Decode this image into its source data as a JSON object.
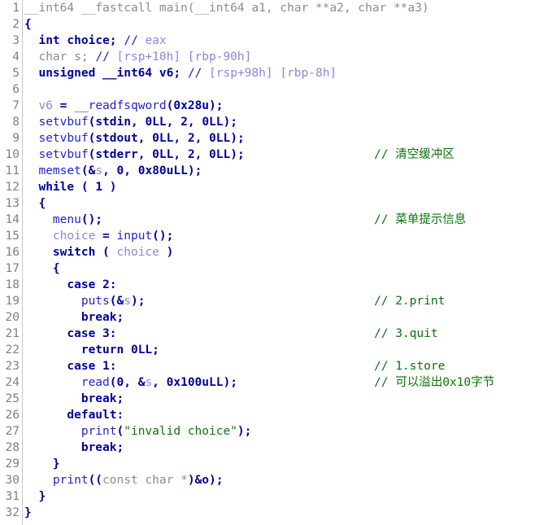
{
  "view": {
    "name": "hex-rays-pseudocode",
    "background": "#ffffff",
    "gutter_color": "#808080",
    "total_lines": 32,
    "colors": {
      "keyword": "#00009a",
      "type_gray": "#8c8c8c",
      "function": "#2424c8",
      "variable": "#8888dd",
      "string": "#087508",
      "comment_green": "#087508",
      "comment_blue": "#8888dd"
    }
  },
  "lines": [
    {
      "n": "1",
      "text": "__int64 __fastcall main(__int64 a1, char **a2, char **a3)",
      "comment": ""
    },
    {
      "n": "2",
      "text": "{",
      "comment": ""
    },
    {
      "n": "3",
      "text": "  int choice; // eax",
      "comment": ""
    },
    {
      "n": "4",
      "text": "  char s; // [rsp+10h] [rbp-90h]",
      "comment": ""
    },
    {
      "n": "5",
      "text": "  unsigned __int64 v6; // [rsp+98h] [rbp-8h]",
      "comment": ""
    },
    {
      "n": "6",
      "text": "",
      "comment": ""
    },
    {
      "n": "7",
      "text": "  v6 = __readfsqword(0x28u);",
      "comment": ""
    },
    {
      "n": "8",
      "text": "  setvbuf(stdin, 0LL, 2, 0LL);",
      "comment": ""
    },
    {
      "n": "9",
      "text": "  setvbuf(stdout, 0LL, 2, 0LL);",
      "comment": ""
    },
    {
      "n": "10",
      "text": "  setvbuf(stderr, 0LL, 2, 0LL);",
      "comment": "// 清空缓冲区"
    },
    {
      "n": "11",
      "text": "  memset(&s, 0, 0x80uLL);",
      "comment": ""
    },
    {
      "n": "12",
      "text": "  while ( 1 )",
      "comment": ""
    },
    {
      "n": "13",
      "text": "  {",
      "comment": ""
    },
    {
      "n": "14",
      "text": "    menu();",
      "comment": "// 菜单提示信息"
    },
    {
      "n": "15",
      "text": "    choice = input();",
      "comment": ""
    },
    {
      "n": "16",
      "text": "    switch ( choice )",
      "comment": ""
    },
    {
      "n": "17",
      "text": "    {",
      "comment": ""
    },
    {
      "n": "18",
      "text": "      case 2:",
      "comment": ""
    },
    {
      "n": "19",
      "text": "        puts(&s);",
      "comment": "// 2.print"
    },
    {
      "n": "20",
      "text": "        break;",
      "comment": ""
    },
    {
      "n": "21",
      "text": "      case 3:",
      "comment": "// 3.quit"
    },
    {
      "n": "22",
      "text": "        return 0LL;",
      "comment": ""
    },
    {
      "n": "23",
      "text": "      case 1:",
      "comment": "// 1.store"
    },
    {
      "n": "24",
      "text": "        read(0, &s, 0x100uLL);",
      "comment": "// 可以溢出0x10字节"
    },
    {
      "n": "25",
      "text": "        break;",
      "comment": ""
    },
    {
      "n": "26",
      "text": "      default:",
      "comment": ""
    },
    {
      "n": "27",
      "text": "        print(\"invalid choice\");",
      "comment": ""
    },
    {
      "n": "28",
      "text": "        break;",
      "comment": ""
    },
    {
      "n": "29",
      "text": "    }",
      "comment": ""
    },
    {
      "n": "30",
      "text": "    print((const char *)&o);",
      "comment": ""
    },
    {
      "n": "31",
      "text": "  }",
      "comment": ""
    },
    {
      "n": "32",
      "text": "}",
      "comment": ""
    }
  ],
  "tokens": {
    "l1": [
      [
        "__int64 __fastcall main(__int64 a1, char **a2, char **a3)",
        "t-type"
      ]
    ],
    "l2": [
      [
        "{",
        "t-punct"
      ]
    ],
    "l3": [
      [
        "  ",
        ""
      ],
      [
        "int",
        "t-kw"
      ],
      [
        " choice",
        "t-kw"
      ],
      [
        ";",
        "t-punct"
      ],
      [
        " ",
        ""
      ],
      [
        "//",
        "t-cmtmk"
      ],
      [
        " eax",
        "t-cmt"
      ]
    ],
    "l4": [
      [
        "  ",
        ""
      ],
      [
        "char s;",
        "t-type"
      ],
      [
        " ",
        ""
      ],
      [
        "//",
        "t-cmtmk"
      ],
      [
        " [rsp+10h] [rbp-90h]",
        "t-cmt"
      ]
    ],
    "l5": [
      [
        "  ",
        ""
      ],
      [
        "unsigned __int64",
        "t-kw"
      ],
      [
        " v6",
        "t-kw"
      ],
      [
        ";",
        "t-punct"
      ],
      [
        " ",
        ""
      ],
      [
        "//",
        "t-cmtmk"
      ],
      [
        " [rsp+98h] [rbp-8h]",
        "t-cmt"
      ]
    ],
    "l6": [
      [
        "",
        ""
      ]
    ],
    "l7": [
      [
        "  ",
        ""
      ],
      [
        "v6",
        "t-var"
      ],
      [
        " = ",
        "t-punct"
      ],
      [
        "__readfsqword",
        "t-fn"
      ],
      [
        "(",
        "t-punct"
      ],
      [
        "0x28u",
        "t-num"
      ],
      [
        ");",
        "t-punct"
      ]
    ],
    "l8": [
      [
        "  ",
        ""
      ],
      [
        "setvbuf",
        "t-fn"
      ],
      [
        "(",
        "t-punct"
      ],
      [
        "stdin",
        "t-plain"
      ],
      [
        ", ",
        "t-punct"
      ],
      [
        "0LL",
        "t-num"
      ],
      [
        ", ",
        "t-punct"
      ],
      [
        "2",
        "t-num"
      ],
      [
        ", ",
        "t-punct"
      ],
      [
        "0LL",
        "t-num"
      ],
      [
        ");",
        "t-punct"
      ]
    ],
    "l9": [
      [
        "  ",
        ""
      ],
      [
        "setvbuf",
        "t-fn"
      ],
      [
        "(",
        "t-punct"
      ],
      [
        "stdout",
        "t-plain"
      ],
      [
        ", ",
        "t-punct"
      ],
      [
        "0LL",
        "t-num"
      ],
      [
        ", ",
        "t-punct"
      ],
      [
        "2",
        "t-num"
      ],
      [
        ", ",
        "t-punct"
      ],
      [
        "0LL",
        "t-num"
      ],
      [
        ");",
        "t-punct"
      ]
    ],
    "l10": [
      [
        "  ",
        ""
      ],
      [
        "setvbuf",
        "t-fn"
      ],
      [
        "(",
        "t-punct"
      ],
      [
        "stderr",
        "t-plain"
      ],
      [
        ", ",
        "t-punct"
      ],
      [
        "0LL",
        "t-num"
      ],
      [
        ", ",
        "t-punct"
      ],
      [
        "2",
        "t-num"
      ],
      [
        ", ",
        "t-punct"
      ],
      [
        "0LL",
        "t-num"
      ],
      [
        ");",
        "t-punct"
      ]
    ],
    "l11": [
      [
        "  ",
        ""
      ],
      [
        "memset",
        "t-fn"
      ],
      [
        "(&",
        "t-punct"
      ],
      [
        "s",
        "t-var"
      ],
      [
        ", ",
        "t-punct"
      ],
      [
        "0",
        "t-num"
      ],
      [
        ", ",
        "t-punct"
      ],
      [
        "0x80uLL",
        "t-num"
      ],
      [
        ");",
        "t-punct"
      ]
    ],
    "l12": [
      [
        "  ",
        ""
      ],
      [
        "while",
        "t-kw"
      ],
      [
        " ( ",
        "t-punct"
      ],
      [
        "1",
        "t-num"
      ],
      [
        " )",
        "t-punct"
      ]
    ],
    "l13": [
      [
        "  ",
        ""
      ],
      [
        "{",
        "t-punct"
      ]
    ],
    "l14": [
      [
        "    ",
        ""
      ],
      [
        "menu",
        "t-fn"
      ],
      [
        "();",
        "t-punct"
      ]
    ],
    "l15": [
      [
        "    ",
        ""
      ],
      [
        "choice",
        "t-var"
      ],
      [
        " = ",
        "t-punct"
      ],
      [
        "input",
        "t-fn"
      ],
      [
        "();",
        "t-punct"
      ]
    ],
    "l16": [
      [
        "    ",
        ""
      ],
      [
        "switch",
        "t-kw"
      ],
      [
        " ( ",
        "t-punct"
      ],
      [
        "choice",
        "t-var"
      ],
      [
        " )",
        "t-punct"
      ]
    ],
    "l17": [
      [
        "    ",
        ""
      ],
      [
        "{",
        "t-punct"
      ]
    ],
    "l18": [
      [
        "      ",
        ""
      ],
      [
        "case",
        "t-kw"
      ],
      [
        " ",
        "t-punct"
      ],
      [
        "2",
        "t-num"
      ],
      [
        ":",
        "t-punct"
      ]
    ],
    "l19": [
      [
        "        ",
        ""
      ],
      [
        "puts",
        "t-fn"
      ],
      [
        "(&",
        "t-punct"
      ],
      [
        "s",
        "t-var"
      ],
      [
        ");",
        "t-punct"
      ]
    ],
    "l20": [
      [
        "        ",
        ""
      ],
      [
        "break",
        "t-kw"
      ],
      [
        ";",
        "t-punct"
      ]
    ],
    "l21": [
      [
        "      ",
        ""
      ],
      [
        "case",
        "t-kw"
      ],
      [
        " ",
        "t-punct"
      ],
      [
        "3",
        "t-num"
      ],
      [
        ":",
        "t-punct"
      ]
    ],
    "l22": [
      [
        "        ",
        ""
      ],
      [
        "return",
        "t-kw"
      ],
      [
        " ",
        "t-punct"
      ],
      [
        "0LL",
        "t-num"
      ],
      [
        ";",
        "t-punct"
      ]
    ],
    "l23": [
      [
        "      ",
        ""
      ],
      [
        "case",
        "t-kw"
      ],
      [
        " ",
        "t-punct"
      ],
      [
        "1",
        "t-num"
      ],
      [
        ":",
        "t-punct"
      ]
    ],
    "l24": [
      [
        "        ",
        ""
      ],
      [
        "read",
        "t-fn"
      ],
      [
        "(",
        "t-punct"
      ],
      [
        "0",
        "t-num"
      ],
      [
        ", &",
        "t-punct"
      ],
      [
        "s",
        "t-var"
      ],
      [
        ", ",
        "t-punct"
      ],
      [
        "0x100uLL",
        "t-num"
      ],
      [
        ");",
        "t-punct"
      ]
    ],
    "l25": [
      [
        "        ",
        ""
      ],
      [
        "break",
        "t-kw"
      ],
      [
        ";",
        "t-punct"
      ]
    ],
    "l26": [
      [
        "      ",
        ""
      ],
      [
        "default",
        "t-kw"
      ],
      [
        ":",
        "t-punct"
      ]
    ],
    "l27": [
      [
        "        ",
        ""
      ],
      [
        "print",
        "t-fn"
      ],
      [
        "(",
        "t-punct"
      ],
      [
        "\"invalid choice\"",
        "t-str"
      ],
      [
        ");",
        "t-punct"
      ]
    ],
    "l28": [
      [
        "        ",
        ""
      ],
      [
        "break",
        "t-kw"
      ],
      [
        ";",
        "t-punct"
      ]
    ],
    "l29": [
      [
        "    ",
        ""
      ],
      [
        "}",
        "t-punct"
      ]
    ],
    "l30": [
      [
        "    ",
        ""
      ],
      [
        "print",
        "t-fn"
      ],
      [
        "((",
        "t-punct"
      ],
      [
        "const char *",
        "t-type"
      ],
      [
        ")&",
        "t-punct"
      ],
      [
        "o",
        "t-plain"
      ],
      [
        ");",
        "t-punct"
      ]
    ],
    "l31": [
      [
        "  ",
        ""
      ],
      [
        "}",
        "t-punct"
      ]
    ],
    "l32": [
      [
        "}",
        "t-punct"
      ]
    ]
  }
}
